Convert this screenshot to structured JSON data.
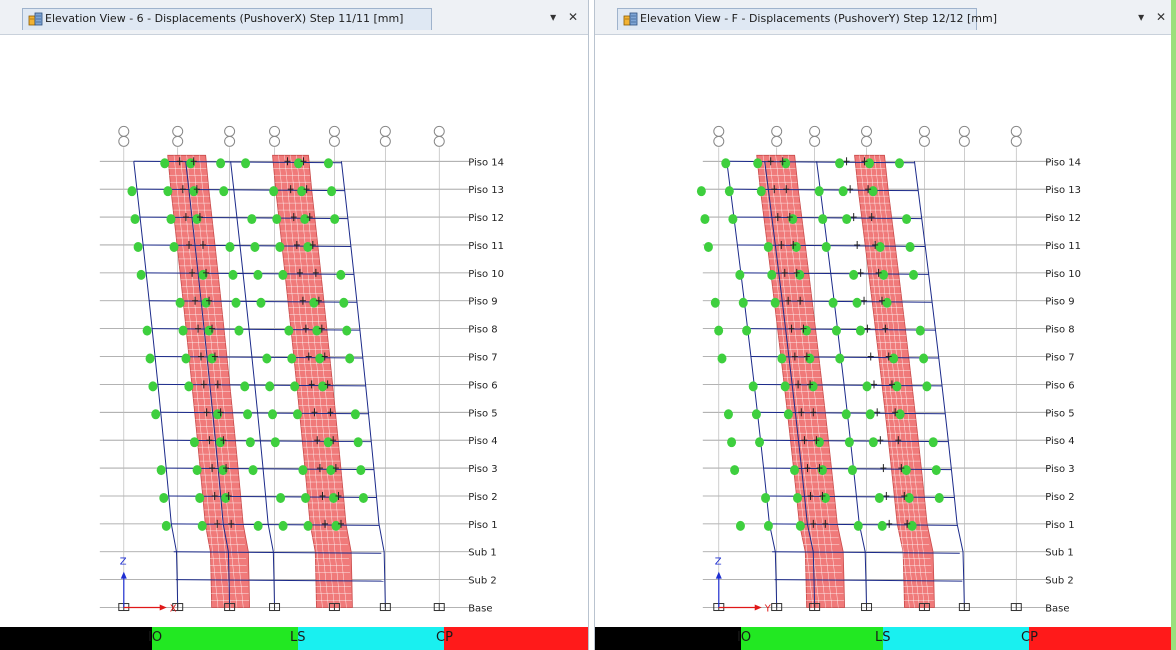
{
  "left_pane": {
    "title": "Elevation View - 6  - Displacements (PushoverX)  Step 11/11  [mm]",
    "legend": {
      "io": "IO",
      "ls": "LS",
      "cp": "CP"
    }
  },
  "right_pane": {
    "title": "Elevation View - F  - Displacements (PushoverY)  Step 12/12  [mm]",
    "legend": {
      "io": "IO",
      "ls": "LS",
      "cp": "CP"
    }
  },
  "window_controls": {
    "dropdown": "▾",
    "close": "✕"
  },
  "story_labels": [
    "Piso 14",
    "Piso 13",
    "Piso 12",
    "Piso 11",
    "Piso 10",
    "Piso 9",
    "Piso 8",
    "Piso 7",
    "Piso 6",
    "Piso 5",
    "Piso 4",
    "Piso 3",
    "Piso 2",
    "Piso 1",
    "Sub 1",
    "Sub 2",
    "Base"
  ],
  "axis_labels": {
    "z": "Z",
    "x": "X",
    "y": "Y"
  },
  "colors": {
    "frame_line": "#1b2a8a",
    "grid_line": "#9a9a9a",
    "wall_fill": "#f07a7a",
    "wall_mesh": "#ffffff",
    "hinge_green": "#3ecf3e",
    "legend_black": "#000000",
    "legend_green": "#22e822",
    "legend_cyan": "#19f0f0",
    "legend_red": "#ff1a1a"
  }
}
